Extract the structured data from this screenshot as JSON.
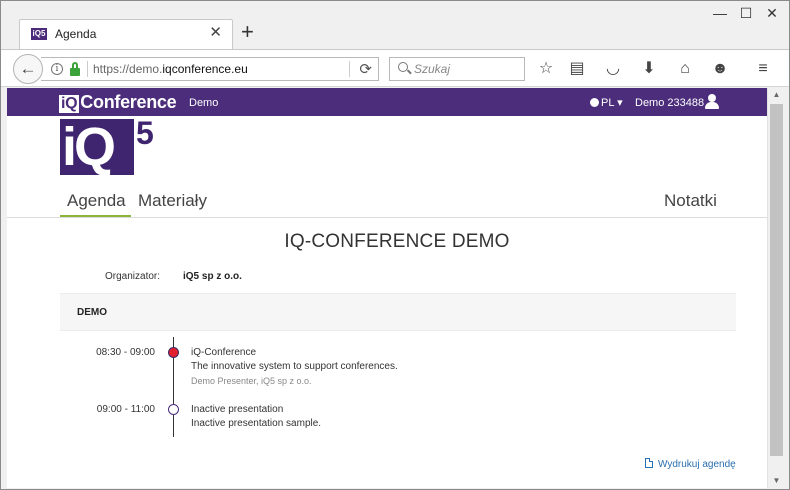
{
  "browser": {
    "tab_title": "Agenda",
    "tab_favicon": "iQ5",
    "new_tab_label": "+",
    "url_prefix": "https://demo.",
    "url_host": "iqconference.eu",
    "search_placeholder": "Szukaj",
    "window_controls": {
      "minimize": "—",
      "maximize": "☐",
      "close": "✕"
    },
    "toolbar_icons": [
      "star-icon",
      "reading-list-icon",
      "pocket-icon",
      "download-icon",
      "home-icon",
      "smiley-icon",
      "menu-icon"
    ]
  },
  "header": {
    "brand_iq": "iQ",
    "brand_rest": "Conference",
    "brand_suffix": "Demo",
    "language": "PL",
    "user": "Demo 233488"
  },
  "logo": {
    "text": "iQ",
    "superscript": "5"
  },
  "tabs": {
    "agenda": "Agenda",
    "materials": "Materiały",
    "notes": "Notatki"
  },
  "event": {
    "title": "IQ-CONFERENCE DEMO",
    "organizer_label": "Organizator:",
    "organizer_value": "iQ5 sp z o.o."
  },
  "day": {
    "label": "DEMO"
  },
  "agenda": [
    {
      "time": "08:30 - 09:00",
      "title": "iQ-Conference",
      "description": "The innovative system to support conferences.",
      "presenter": "Demo Presenter, iQ5 sp z o.o.",
      "status": "active"
    },
    {
      "time": "09:00 - 11:00",
      "title": "Inactive presentation",
      "description": "Inactive presentation sample.",
      "presenter": "",
      "status": "inactive"
    }
  ],
  "print_link": "Wydrukuj agendę",
  "colors": {
    "brand": "#4b2d7b",
    "accent_tab": "#8cb33a",
    "active_dot": "#e21f2c",
    "link": "#2a6fb0"
  }
}
